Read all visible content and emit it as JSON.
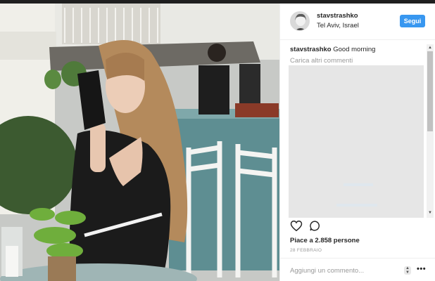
{
  "post": {
    "username": "stavstrashko",
    "location": "Tel Aviv, Israel",
    "follow_label": "Segui",
    "caption_user": "stavstrashko",
    "caption_text": " Good morning",
    "load_more": "Carica altri commenti",
    "likes_prefix": "Piace a ",
    "likes_count": "2.858",
    "likes_suffix": " persone",
    "date": "28 FEBBRAIO",
    "add_comment_placeholder": "Aggiungi un commento..."
  },
  "icons": {
    "like": "heart-icon",
    "comment": "comment-icon",
    "more": "more-options-icon",
    "avatar": "avatar",
    "sort": "up-down-arrows-icon"
  },
  "colors": {
    "accent": "#3897f0",
    "text": "#262626",
    "muted": "#999999",
    "border": "#efefef"
  }
}
